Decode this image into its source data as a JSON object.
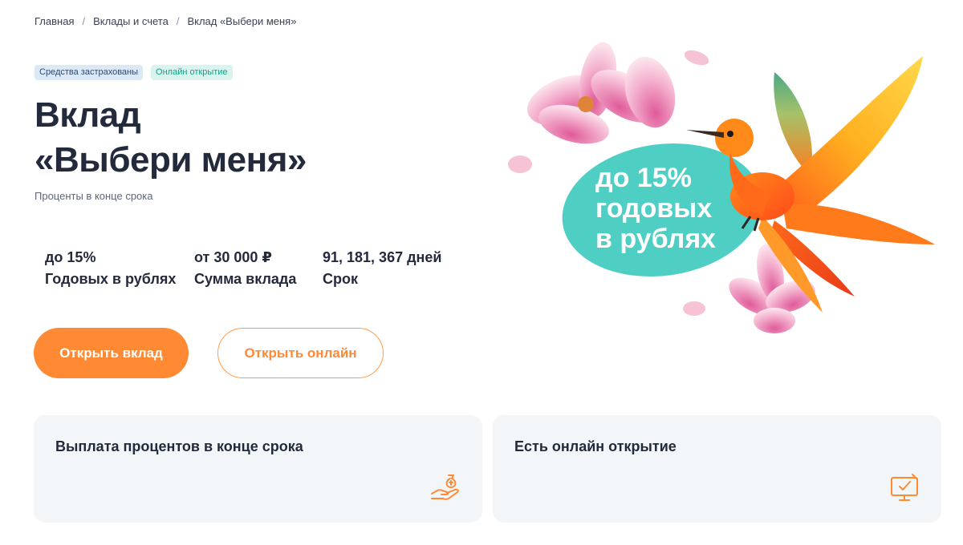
{
  "breadcrumb": {
    "items": [
      "Главная",
      "Вклады и счета",
      "Вклад «Выбери меня»"
    ],
    "separator": "/"
  },
  "badges": [
    "Средства застрахованы",
    "Онлайн открытие"
  ],
  "title": {
    "line1": "Вклад",
    "line2": "«Выбери меня»"
  },
  "subtitle": "Проценты в конце срока",
  "params": [
    {
      "value": "до 15%",
      "label": "Годовых в рублях"
    },
    {
      "value": "от 30 000 ₽",
      "label": "Сумма вклада"
    },
    {
      "value": "91, 181, 367 дней",
      "label": "Срок"
    }
  ],
  "buttons": {
    "primary": "Открыть вклад",
    "secondary": "Открыть онлайн"
  },
  "promo": {
    "line1": "до 15%",
    "line2": "годовых",
    "line3": "в рублях"
  },
  "cards": [
    {
      "title": "Выплата процентов в конце срока",
      "icon": "hand-money-bag-icon"
    },
    {
      "title": "Есть онлайн открытие",
      "icon": "monitor-check-icon"
    }
  ],
  "colors": {
    "accent": "#ff8a33",
    "promo_bubble": "#4fcfc4",
    "card_bg": "#f3f6f9"
  }
}
